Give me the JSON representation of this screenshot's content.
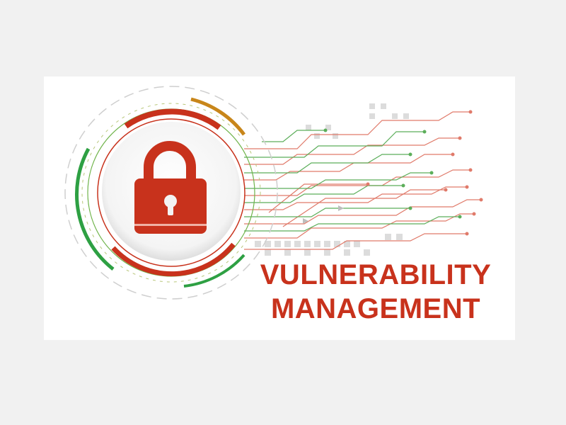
{
  "title": {
    "line1": "VULNERABILITY",
    "line2": "MANAGEMENT"
  },
  "icons": {
    "lock": "padlock-icon",
    "circuit": "circuit-lines",
    "rings": "progress-rings"
  },
  "colors": {
    "accent_red": "#c8321c",
    "ring_green": "#2ea043",
    "ring_orange": "#c8861a",
    "circuit_red": "#e07a6a",
    "circuit_green": "#5cae5a",
    "background": "#f1f1f1"
  }
}
